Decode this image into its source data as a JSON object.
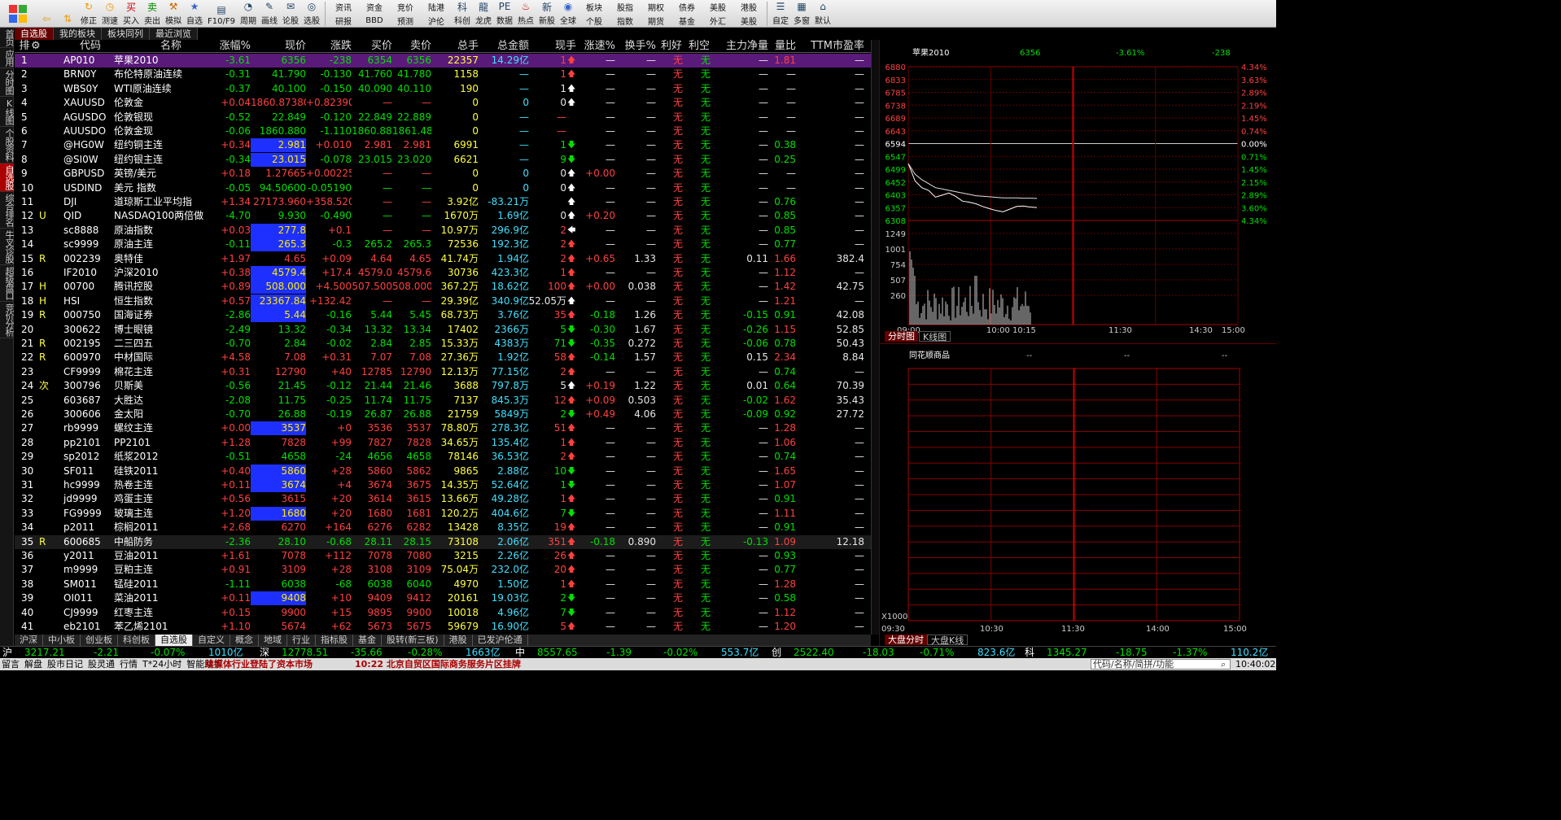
{
  "toolbar": {
    "buttons": [
      {
        "label": "",
        "icon": "back-arrow-icon"
      },
      {
        "label": "",
        "icon": "up-down-icon"
      },
      {
        "label": "修正",
        "icon": "refresh-icon"
      },
      {
        "label": "测速",
        "icon": "clock-icon"
      },
      {
        "label": "买入",
        "icon": "buy-icon"
      },
      {
        "label": "卖出",
        "icon": "sell-icon"
      },
      {
        "label": "模拟",
        "icon": "hammer-icon"
      },
      {
        "label": "自选",
        "icon": "star-icon"
      },
      {
        "label": "F10/F9",
        "icon": "f10-icon"
      },
      {
        "label": "周期",
        "icon": "cycle-icon"
      },
      {
        "label": "画线",
        "icon": "pen-icon"
      },
      {
        "label": "论股",
        "icon": "chat-icon"
      },
      {
        "label": "选股",
        "icon": "select-icon"
      }
    ],
    "grid": [
      [
        "资讯",
        "研报"
      ],
      [
        "资金",
        "BBD"
      ],
      [
        "竞价",
        "预测"
      ],
      [
        "陆港",
        "沪伦"
      ]
    ],
    "buttons2": [
      {
        "label": "科创",
        "icon": "kc-icon"
      },
      {
        "label": "龙虎",
        "icon": "dragon-icon"
      },
      {
        "label": "数据",
        "icon": "pe-icon"
      },
      {
        "label": "热点",
        "icon": "fire-icon"
      },
      {
        "label": "新股",
        "icon": "new-icon"
      },
      {
        "label": "全球",
        "icon": "globe-icon"
      }
    ],
    "grid2": [
      [
        "板块",
        "个股"
      ],
      [
        "股指",
        "指数"
      ],
      [
        "期权",
        "期货"
      ],
      [
        "债券",
        "基金"
      ],
      [
        "美股",
        "外汇"
      ],
      [
        "港股",
        "美股"
      ]
    ],
    "buttons3": [
      {
        "label": "自定",
        "icon": "custom-icon"
      },
      {
        "label": "多窗",
        "icon": "multi-window-icon"
      },
      {
        "label": "默认",
        "icon": "default-icon"
      }
    ]
  },
  "sidenav": [
    "首页",
    "应用",
    "分时图",
    "K线图",
    "个股资料",
    "自选股",
    "综合排名",
    "牛叉诊股",
    "超级盘口",
    "竞价分析"
  ],
  "tabs": [
    "自选股",
    "我的板块",
    "板块同列",
    "最近浏览"
  ],
  "columns": [
    "排",
    "代码",
    "名称",
    "涨幅%",
    "现价",
    "涨跌",
    "买价",
    "卖价",
    "总手",
    "总金额",
    "现手",
    "涨速%",
    "换手%",
    "利好",
    "利空",
    "主力净量",
    "量比",
    "TTM市盈率"
  ],
  "rows": [
    [
      "1",
      "",
      "AP010",
      "苹果2010",
      "-3.61",
      "6356",
      "-238",
      "6354",
      "6356",
      "22357",
      "14.29亿",
      "1",
      "up",
      "—",
      "—",
      "无",
      "无",
      "—",
      "1.81",
      "—"
    ],
    [
      "2",
      "",
      "BRN0Y",
      "布伦特原油连续",
      "-0.31",
      "41.790",
      "-0.130",
      "41.760",
      "41.780",
      "1158",
      "—",
      "1",
      "up",
      "—",
      "—",
      "无",
      "无",
      "—",
      "—",
      "—"
    ],
    [
      "3",
      "",
      "WBS0Y",
      "WTI原油连续",
      "-0.37",
      "40.100",
      "-0.150",
      "40.090",
      "40.110",
      "190",
      "—",
      "1",
      "upw",
      "—",
      "—",
      "无",
      "无",
      "—",
      "—",
      "—"
    ],
    [
      "4",
      "",
      "XAUUSD",
      "伦敦金",
      "+0.04",
      "1860.87380",
      "+0.82390",
      "—",
      "—",
      "0",
      "0",
      "0",
      "upw",
      "—",
      "—",
      "无",
      "无",
      "—",
      "—",
      "—"
    ],
    [
      "5",
      "",
      "AGUSDO",
      "伦敦银现",
      "-0.52",
      "22.849",
      "-0.120",
      "22.849",
      "22.889",
      "0",
      "—",
      "—",
      "",
      "—",
      "—",
      "无",
      "无",
      "—",
      "—",
      "—"
    ],
    [
      "6",
      "",
      "AUUSDO",
      "伦敦金现",
      "-0.06",
      "1860.880",
      "-1.110",
      "1860.880",
      "1861.480",
      "0",
      "—",
      "—",
      "",
      "—",
      "—",
      "无",
      "无",
      "—",
      "—",
      "—"
    ],
    [
      "7",
      "",
      "@HG0W",
      "纽约铜主连",
      "+0.34",
      "2.981",
      "+0.010",
      "2.981",
      "2.981",
      "6991",
      "—",
      "1",
      "dn",
      "—",
      "—",
      "无",
      "无",
      "—",
      "0.38",
      "—"
    ],
    [
      "8",
      "",
      "@SI0W",
      "纽约银主连",
      "-0.34",
      "23.015",
      "-0.078",
      "23.015",
      "23.020",
      "6621",
      "—",
      "9",
      "dn",
      "—",
      "—",
      "无",
      "无",
      "—",
      "0.25",
      "—"
    ],
    [
      "9",
      "",
      "GBPUSD",
      "英镑/美元",
      "+0.18",
      "1.27665",
      "+0.00225",
      "—",
      "—",
      "0",
      "0",
      "0",
      "upw",
      "+0.00",
      "—",
      "无",
      "无",
      "—",
      "—",
      "—"
    ],
    [
      "10",
      "",
      "USDIND",
      "美元 指数",
      "-0.05",
      "94.50600",
      "-0.05190",
      "—",
      "—",
      "0",
      "0",
      "0",
      "upw",
      "—",
      "—",
      "无",
      "无",
      "—",
      "—",
      "—"
    ],
    [
      "11",
      "",
      "DJI",
      "道琼斯工业平均指",
      "+1.34",
      "27173.960",
      "+358.520",
      "—",
      "—",
      "3.92亿",
      "-83.21万",
      "",
      "upw",
      "—",
      "—",
      "无",
      "无",
      "—",
      "0.76",
      "—"
    ],
    [
      "12",
      "U",
      "QID",
      "NASDAQ100两倍做",
      "-4.70",
      "9.930",
      "-0.490",
      "—",
      "—",
      "1670万",
      "1.69亿",
      "0",
      "upw",
      "+0.20",
      "—",
      "无",
      "无",
      "—",
      "0.85",
      "—"
    ],
    [
      "13",
      "",
      "sc8888",
      "原油指数",
      "+0.03",
      "277.8",
      "+0.1",
      "—",
      "—",
      "10.97万",
      "296.9亿",
      "2",
      "lt",
      "—",
      "—",
      "无",
      "无",
      "—",
      "0.85",
      "—"
    ],
    [
      "14",
      "",
      "sc9999",
      "原油主连",
      "-0.11",
      "265.3",
      "-0.3",
      "265.2",
      "265.3",
      "72536",
      "192.3亿",
      "2",
      "up",
      "—",
      "—",
      "无",
      "无",
      "—",
      "0.77",
      "—"
    ],
    [
      "15",
      "R",
      "002239",
      "奥特佳",
      "+1.97",
      "4.65",
      "+0.09",
      "4.64",
      "4.65",
      "41.74万",
      "1.94亿",
      "2",
      "up",
      "+0.65",
      "1.33",
      "无",
      "无",
      "0.11",
      "1.66",
      "382.4"
    ],
    [
      "16",
      "",
      "IF2010",
      "沪深2010",
      "+0.38",
      "4579.4",
      "+17.4",
      "4579.0",
      "4579.6",
      "30736",
      "423.3亿",
      "1",
      "up",
      "—",
      "—",
      "无",
      "无",
      "—",
      "1.12",
      "—"
    ],
    [
      "17",
      "H",
      "00700",
      "腾讯控股",
      "+0.89",
      "508.000",
      "+4.500",
      "507.500",
      "508.000",
      "367.2万",
      "18.62亿",
      "100",
      "up",
      "+0.00",
      "0.038",
      "无",
      "无",
      "—",
      "1.42",
      "42.75"
    ],
    [
      "18",
      "H",
      "HSI",
      "恒生指数",
      "+0.57",
      "23367.84",
      "+132.42",
      "—",
      "—",
      "29.39亿",
      "340.9亿",
      "52.05万",
      "upw",
      "—",
      "—",
      "无",
      "无",
      "—",
      "1.21",
      "—"
    ],
    [
      "19",
      "R",
      "000750",
      "国海证券",
      "-2.86",
      "5.44",
      "-0.16",
      "5.44",
      "5.45",
      "68.73万",
      "3.76亿",
      "35",
      "up",
      "-0.18",
      "1.26",
      "无",
      "无",
      "-0.15",
      "0.91",
      "42.08"
    ],
    [
      "20",
      "",
      "300622",
      "博士眼镜",
      "-2.49",
      "13.32",
      "-0.34",
      "13.32",
      "13.34",
      "17402",
      "2366万",
      "5",
      "dn",
      "-0.30",
      "1.67",
      "无",
      "无",
      "-0.26",
      "1.15",
      "52.85"
    ],
    [
      "21",
      "R",
      "002195",
      "二三四五",
      "-0.70",
      "2.84",
      "-0.02",
      "2.84",
      "2.85",
      "15.33万",
      "4383万",
      "71",
      "dn",
      "-0.35",
      "0.272",
      "无",
      "无",
      "-0.06",
      "0.78",
      "50.43"
    ],
    [
      "22",
      "R",
      "600970",
      "中材国际",
      "+4.58",
      "7.08",
      "+0.31",
      "7.07",
      "7.08",
      "27.36万",
      "1.92亿",
      "58",
      "up",
      "-0.14",
      "1.57",
      "无",
      "无",
      "0.15",
      "2.34",
      "8.84"
    ],
    [
      "23",
      "",
      "CF9999",
      "棉花主连",
      "+0.31",
      "12790",
      "+40",
      "12785",
      "12790",
      "12.13万",
      "77.15亿",
      "2",
      "up",
      "—",
      "—",
      "无",
      "无",
      "—",
      "0.74",
      "—"
    ],
    [
      "24",
      "次",
      "300796",
      "贝斯美",
      "-0.56",
      "21.45",
      "-0.12",
      "21.44",
      "21.46",
      "3688",
      "797.8万",
      "5",
      "upw",
      "+0.19",
      "1.22",
      "无",
      "无",
      "0.01",
      "0.64",
      "70.39"
    ],
    [
      "25",
      "",
      "603687",
      "大胜达",
      "-2.08",
      "11.75",
      "-0.25",
      "11.74",
      "11.75",
      "7137",
      "845.3万",
      "12",
      "up",
      "+0.09",
      "0.503",
      "无",
      "无",
      "-0.02",
      "1.62",
      "35.43"
    ],
    [
      "26",
      "",
      "300606",
      "金太阳",
      "-0.70",
      "26.88",
      "-0.19",
      "26.87",
      "26.88",
      "21759",
      "5849万",
      "2",
      "dn",
      "+0.49",
      "4.06",
      "无",
      "无",
      "-0.09",
      "0.92",
      "27.72"
    ],
    [
      "27",
      "",
      "rb9999",
      "螺纹主连",
      "+0.00",
      "3537",
      "+0",
      "3536",
      "3537",
      "78.80万",
      "278.3亿",
      "51",
      "up",
      "—",
      "—",
      "无",
      "无",
      "—",
      "1.28",
      "—"
    ],
    [
      "28",
      "",
      "pp2101",
      "PP2101",
      "+1.28",
      "7828",
      "+99",
      "7827",
      "7828",
      "34.65万",
      "135.4亿",
      "1",
      "up",
      "—",
      "—",
      "无",
      "无",
      "—",
      "1.06",
      "—"
    ],
    [
      "29",
      "",
      "sp2012",
      "纸浆2012",
      "-0.51",
      "4658",
      "-24",
      "4656",
      "4658",
      "78146",
      "36.53亿",
      "2",
      "up",
      "—",
      "—",
      "无",
      "无",
      "—",
      "0.74",
      "—"
    ],
    [
      "30",
      "",
      "SF011",
      "硅铁2011",
      "+0.40",
      "5860",
      "+28",
      "5860",
      "5862",
      "9865",
      "2.88亿",
      "10",
      "dn",
      "—",
      "—",
      "无",
      "无",
      "—",
      "1.65",
      "—"
    ],
    [
      "31",
      "",
      "hc9999",
      "热卷主连",
      "+0.11",
      "3674",
      "+4",
      "3674",
      "3675",
      "14.35万",
      "52.64亿",
      "1",
      "dn",
      "—",
      "—",
      "无",
      "无",
      "—",
      "1.07",
      "—"
    ],
    [
      "32",
      "",
      "jd9999",
      "鸡蛋主连",
      "+0.56",
      "3615",
      "+20",
      "3614",
      "3615",
      "13.66万",
      "49.28亿",
      "1",
      "up",
      "—",
      "—",
      "无",
      "无",
      "—",
      "0.91",
      "—"
    ],
    [
      "33",
      "",
      "FG9999",
      "玻璃主连",
      "+1.20",
      "1680",
      "+20",
      "1680",
      "1681",
      "120.2万",
      "404.6亿",
      "7",
      "dn",
      "—",
      "—",
      "无",
      "无",
      "—",
      "1.11",
      "—"
    ],
    [
      "34",
      "",
      "p2011",
      "棕榈2011",
      "+2.68",
      "6270",
      "+164",
      "6276",
      "6282",
      "13428",
      "8.35亿",
      "19",
      "up",
      "—",
      "—",
      "无",
      "无",
      "—",
      "0.91",
      "—"
    ],
    [
      "35",
      "R",
      "600685",
      "中船防务",
      "-2.36",
      "28.10",
      "-0.68",
      "28.11",
      "28.15",
      "73108",
      "2.06亿",
      "351",
      "up",
      "-0.18",
      "0.890",
      "无",
      "无",
      "-0.13",
      "1.09",
      "12.18"
    ],
    [
      "36",
      "",
      "y2011",
      "豆油2011",
      "+1.61",
      "7078",
      "+112",
      "7078",
      "7080",
      "3215",
      "2.26亿",
      "26",
      "up",
      "—",
      "—",
      "无",
      "无",
      "—",
      "0.93",
      "—"
    ],
    [
      "37",
      "",
      "m9999",
      "豆粕主连",
      "+0.91",
      "3109",
      "+28",
      "3108",
      "3109",
      "75.04万",
      "232.0亿",
      "20",
      "up",
      "—",
      "—",
      "无",
      "无",
      "—",
      "0.77",
      "—"
    ],
    [
      "38",
      "",
      "SM011",
      "锰硅2011",
      "-1.11",
      "6038",
      "-68",
      "6038",
      "6040",
      "4970",
      "1.50亿",
      "1",
      "up",
      "—",
      "—",
      "无",
      "无",
      "—",
      "1.28",
      "—"
    ],
    [
      "39",
      "",
      "OI011",
      "菜油2011",
      "+0.11",
      "9408",
      "+10",
      "9409",
      "9412",
      "20161",
      "19.03亿",
      "2",
      "dn",
      "—",
      "—",
      "无",
      "无",
      "—",
      "0.58",
      "—"
    ],
    [
      "40",
      "",
      "CJ9999",
      "红枣主连",
      "+0.15",
      "9900",
      "+15",
      "9895",
      "9900",
      "10018",
      "4.96亿",
      "7",
      "dn",
      "—",
      "—",
      "无",
      "无",
      "—",
      "1.12",
      "—"
    ],
    [
      "41",
      "",
      "eb2101",
      "苯乙烯2101",
      "+1.10",
      "5674",
      "+62",
      "5673",
      "5675",
      "59679",
      "16.90亿",
      "5",
      "up",
      "—",
      "—",
      "无",
      "无",
      "—",
      "1.20",
      "—"
    ]
  ],
  "blue_rows": [
    7,
    8,
    13,
    14,
    16,
    17,
    18,
    19,
    27,
    30,
    31,
    33,
    39
  ],
  "subtabs": [
    "沪深",
    "中小板",
    "创业板",
    "科创板",
    "自选股",
    "自定义",
    "概念",
    "地域",
    "行业",
    "指标股",
    "基金",
    "股转(新三板)",
    "港股",
    "已发沪伦通"
  ],
  "index_bar": [
    {
      "name": "沪",
      "value": "3217.21",
      "chg": "-2.21",
      "pct": "-0.07%",
      "amt": "1010亿"
    },
    {
      "name": "深",
      "value": "12778.51",
      "chg": "-35.66",
      "pct": "-0.28%",
      "amt": "1663亿"
    },
    {
      "name": "中",
      "value": "8557.65",
      "chg": "-1.39",
      "pct": "-0.02%",
      "amt": "553.7亿"
    },
    {
      "name": "创",
      "value": "2522.40",
      "chg": "-18.03",
      "pct": "-0.71%",
      "amt": "823.6亿"
    },
    {
      "name": "科",
      "value": "1345.27",
      "chg": "-18.75",
      "pct": "-1.37%",
      "amt": "110.2亿"
    }
  ],
  "status": {
    "items": [
      "留言",
      "解盘",
      "股市日记",
      "股灵通",
      "行情",
      "T*24小时",
      "智能助手"
    ],
    "news1": "续媒体行业登陆了资本市场",
    "news2": "10:22 北京自贸区国际商务服务片区挂牌",
    "search_placeholder": "代码/名称/简拼/功能",
    "time": "10:40:02"
  },
  "chart": {
    "title": "苹果2010",
    "price": "6356",
    "pct": "-3.61%",
    "chg": "-238",
    "y_left": [
      "6880",
      "6833",
      "6785",
      "6738",
      "6689",
      "6643",
      "6594",
      "6547",
      "6499",
      "6452",
      "6403",
      "6357",
      "6308"
    ],
    "y_right": [
      "4.34%",
      "3.63%",
      "2.89%",
      "2.19%",
      "1.45%",
      "0.74%",
      "0.00%",
      "0.71%",
      "1.45%",
      "2.15%",
      "2.89%",
      "3.60%",
      "4.34%"
    ],
    "vol_ticks": [
      "1249",
      "1001",
      "754",
      "507",
      "260"
    ],
    "x_labels": [
      "09:00",
      "10:00 10:15",
      "11:30",
      "14:30",
      "15:00"
    ],
    "tabs": [
      "分时图",
      "K线图"
    ]
  },
  "chart2": {
    "title": "同花顺商品",
    "cols": [
      "--",
      "--",
      "--"
    ],
    "ylabel": "X1000",
    "x_labels": [
      "09:30",
      "10:30",
      "11:30",
      "14:00",
      "15:00"
    ],
    "tabs": [
      "大盘分时",
      "大盘K线"
    ]
  },
  "chart_data": [
    {
      "type": "line",
      "title": "苹果2010",
      "series": [
        {
          "values": [
            6520,
            6455,
            6430,
            6420,
            6395,
            6402,
            6410,
            6398,
            6380,
            6376,
            6370,
            6360,
            6352,
            6345,
            6340,
            6350,
            6360,
            6362,
            6358,
            6356
          ]
        },
        {
          "values": [
            6520,
            6480,
            6460,
            6445,
            6430,
            6425,
            6420,
            6415,
            6410,
            6405,
            6400,
            6398,
            6396,
            6394,
            6392,
            6392,
            6392,
            6391,
            6391,
            6390
          ]
        }
      ],
      "ylim": [
        6308,
        6880
      ]
    }
  ]
}
